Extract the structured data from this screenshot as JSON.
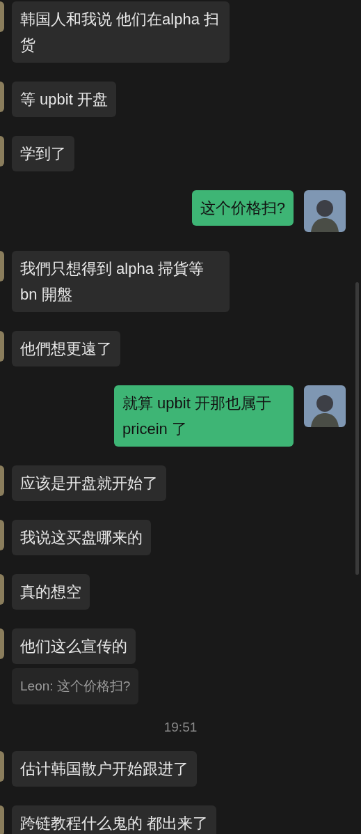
{
  "messages": [
    {
      "kind": "incoming",
      "text": "韩国人和我说 他们在alpha 扫货"
    },
    {
      "kind": "incoming",
      "text": "等 upbit 开盘"
    },
    {
      "kind": "incoming",
      "text": "学到了"
    },
    {
      "kind": "outgoing",
      "text": "这个价格扫?"
    },
    {
      "kind": "incoming",
      "text": "我們只想得到 alpha 掃貨等 bn 開盤"
    },
    {
      "kind": "incoming",
      "text": "他們想更遠了"
    },
    {
      "kind": "outgoing",
      "text": "就算 upbit 开那也属于 pricein 了"
    },
    {
      "kind": "incoming",
      "text": "应该是开盘就开始了"
    },
    {
      "kind": "incoming",
      "text": "我说这买盘哪来的"
    },
    {
      "kind": "incoming",
      "text": "真的想空"
    },
    {
      "kind": "incoming",
      "text": "他们这么宣传的"
    },
    {
      "kind": "quote",
      "text": "Leon: 这个价格扫?"
    },
    {
      "kind": "time",
      "text": "19:51"
    },
    {
      "kind": "incoming",
      "text": "估计韩国散户开始跟进了"
    },
    {
      "kind": "incoming",
      "text": "跨链教程什么鬼的 都出来了"
    }
  ]
}
